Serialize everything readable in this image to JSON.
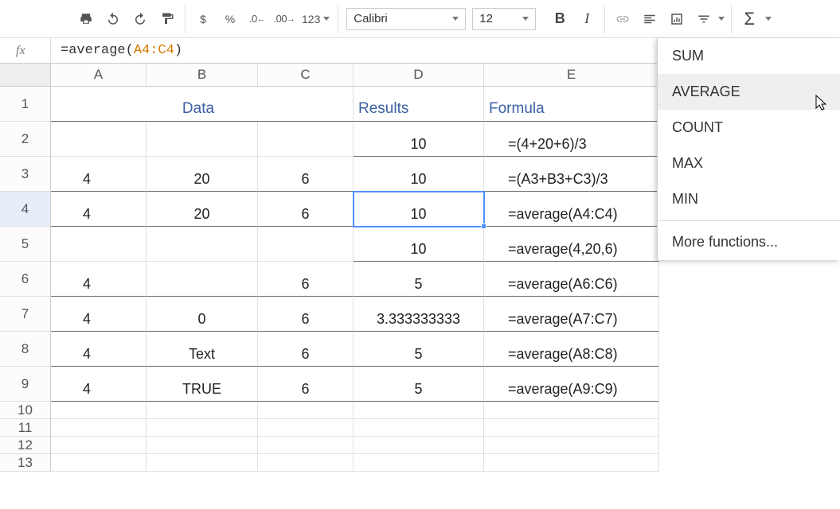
{
  "toolbar": {
    "currency": "$",
    "percent": "%",
    "dec_inc": ".0←",
    "dec_dec": ".00→",
    "num_format": "123",
    "font_name": "Calibri",
    "font_size": "12",
    "bold": "B",
    "italic": "I",
    "sigma": "Σ"
  },
  "formula_bar": {
    "fx": "fx",
    "prefix": "=average(",
    "range": "A4:C4",
    "suffix": ")"
  },
  "columns": [
    "A",
    "B",
    "C",
    "D",
    "E"
  ],
  "row_numbers": [
    "1",
    "2",
    "3",
    "4",
    "5",
    "6",
    "7",
    "8",
    "9",
    "10",
    "11",
    "12",
    "13"
  ],
  "sheet": {
    "header_data": "Data",
    "header_results": "Results",
    "header_formula": "Formula",
    "rows": [
      {
        "a": "",
        "b": "",
        "c": "",
        "d": "10",
        "e": "=(4+20+6)/3"
      },
      {
        "a": "4",
        "b": "20",
        "c": "6",
        "d": "10",
        "e": "=(A3+B3+C3)/3"
      },
      {
        "a": "4",
        "b": "20",
        "c": "6",
        "d": "10",
        "e": "=average(A4:C4)"
      },
      {
        "a": "",
        "b": "",
        "c": "",
        "d": "10",
        "e": "=average(4,20,6)"
      },
      {
        "a": "4",
        "b": "",
        "c": "6",
        "d": "5",
        "e": "=average(A6:C6)"
      },
      {
        "a": "4",
        "b": "0",
        "c": "6",
        "d": "3.333333333",
        "e": "=average(A7:C7)"
      },
      {
        "a": "4",
        "b": "Text",
        "c": "6",
        "d": "5",
        "e": "=average(A8:C8)"
      },
      {
        "a": "4",
        "b": "TRUE",
        "c": "6",
        "d": "5",
        "e": "=average(A9:C9)"
      }
    ]
  },
  "fn_menu": {
    "sum": "SUM",
    "average": "AVERAGE",
    "count": "COUNT",
    "max": "MAX",
    "min": "MIN",
    "more": "More functions..."
  }
}
